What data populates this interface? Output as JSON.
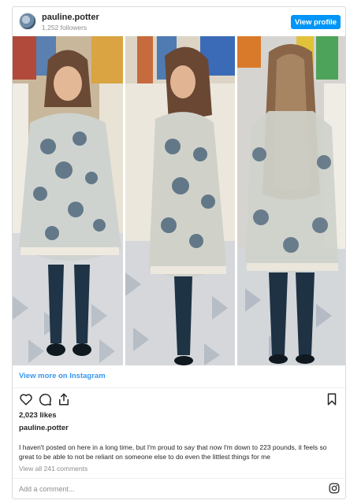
{
  "header": {
    "username": "pauline.potter",
    "followers": "1,252 followers",
    "view_profile_label": "View profile"
  },
  "media": {
    "panels": [
      "front-view-photo",
      "side-view-photo",
      "back-view-photo"
    ]
  },
  "view_more_label": "View more on Instagram",
  "actions": {
    "icons": [
      "heart-icon",
      "comment-icon",
      "share-icon",
      "bookmark-icon"
    ]
  },
  "likes": "2,023 likes",
  "owner": "pauline.potter",
  "caption": "I haven't posted on here in a long time, but I'm proud to say that now I'm down to 223 pounds, it feels so great to be able to not be reliant on someone else to do even the littlest things for me",
  "comments_link": "View all 241 comments",
  "add_comment_placeholder": "Add a comment...",
  "colors": {
    "accent": "#0095f6",
    "link": "#3897f0",
    "border": "#dbdbdb",
    "muted": "#8e8e8e"
  }
}
